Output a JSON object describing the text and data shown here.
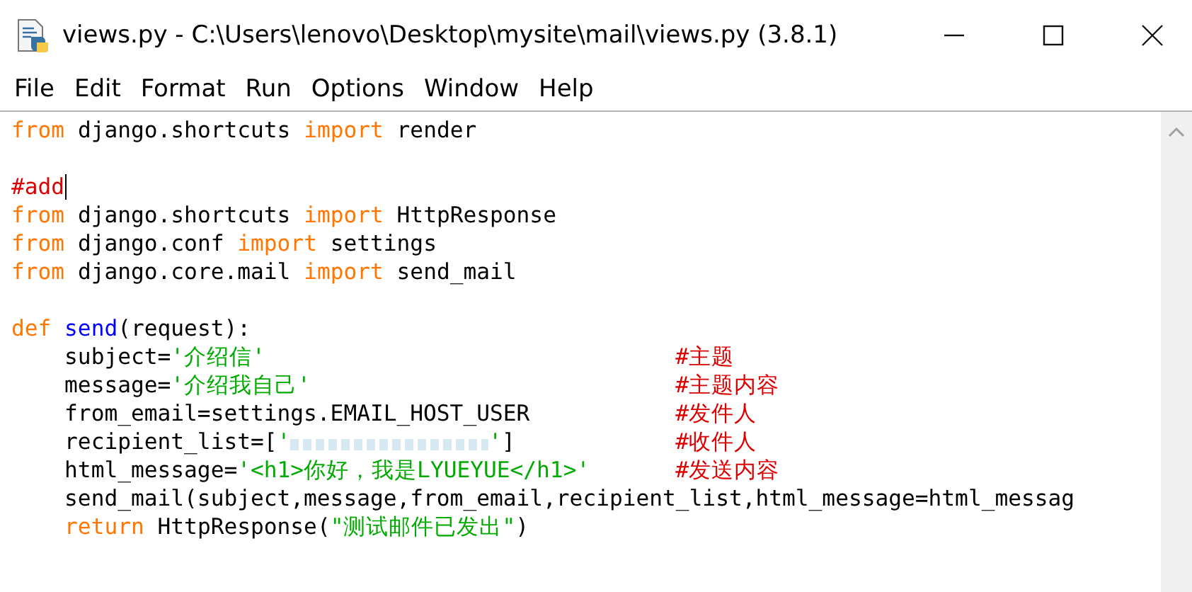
{
  "window": {
    "title": "views.py - C:\\Users\\lenovo\\Desktop\\mysite\\mail\\views.py (3.8.1)"
  },
  "menu": [
    "File",
    "Edit",
    "Format",
    "Run",
    "Options",
    "Window",
    "Help"
  ],
  "editor": {
    "lines": [
      {
        "tokens": [
          {
            "kind": "keyword",
            "text": "from"
          },
          {
            "kind": "plain",
            "text": " django.shortcuts "
          },
          {
            "kind": "keyword",
            "text": "import"
          },
          {
            "kind": "plain",
            "text": " render"
          }
        ]
      },
      {
        "blank": true
      },
      {
        "tokens": [
          {
            "kind": "comment",
            "text": "#add"
          }
        ],
        "cursor": true
      },
      {
        "tokens": [
          {
            "kind": "keyword",
            "text": "from"
          },
          {
            "kind": "plain",
            "text": " django.shortcuts "
          },
          {
            "kind": "keyword",
            "text": "import"
          },
          {
            "kind": "plain",
            "text": " HttpResponse"
          }
        ]
      },
      {
        "tokens": [
          {
            "kind": "keyword",
            "text": "from"
          },
          {
            "kind": "plain",
            "text": " django.conf "
          },
          {
            "kind": "keyword",
            "text": "import"
          },
          {
            "kind": "plain",
            "text": " settings"
          }
        ]
      },
      {
        "tokens": [
          {
            "kind": "keyword",
            "text": "from"
          },
          {
            "kind": "plain",
            "text": " django.core.mail "
          },
          {
            "kind": "keyword",
            "text": "import"
          },
          {
            "kind": "plain",
            "text": " send_mail"
          }
        ]
      },
      {
        "blank": true
      },
      {
        "tokens": [
          {
            "kind": "keyword",
            "text": "def"
          },
          {
            "kind": "definition",
            "text": "send"
          },
          {
            "kind": "plain",
            "text": "(request):"
          }
        ],
        "children": [
          {
            "tokens": [
              {
                "kind": "plain",
                "text": "subject="
              },
              {
                "kind": "string",
                "text": "'介绍信'"
              }
            ],
            "comment": "#主题"
          },
          {
            "tokens": [
              {
                "kind": "plain",
                "text": "message="
              },
              {
                "kind": "string",
                "text": "'介绍我自己'"
              }
            ],
            "comment": "#主题内容"
          },
          {
            "tokens": [
              {
                "kind": "plain",
                "text": "from_email=settings.EMAIL_HOST_USER"
              }
            ],
            "comment": "#发件人"
          },
          {
            "tokens": [
              {
                "kind": "plain",
                "text": "recipient_list=["
              },
              {
                "kind": "string",
                "text": "'"
              },
              {
                "kind": "redacted"
              },
              {
                "kind": "string",
                "text": "'"
              },
              {
                "kind": "plain",
                "text": "]"
              }
            ],
            "comment": "#收件人"
          },
          {
            "tokens": [
              {
                "kind": "plain",
                "text": "html_message="
              },
              {
                "kind": "string",
                "text": "'<h1>你好，我是LYUEYUE</h1>'"
              }
            ],
            "comment": "#发送内容"
          },
          {
            "tokens": [
              {
                "kind": "plain",
                "text": "send_mail(subject,message,from_email,recipient_list,html_message=html_messag"
              }
            ]
          },
          {
            "tokens": [
              {
                "kind": "keyword",
                "text": "return"
              },
              {
                "kind": "plain",
                "text": " HttpResponse("
              },
              {
                "kind": "string",
                "text": "\"测试邮件已发出\""
              },
              {
                "kind": "plain",
                "text": ")"
              }
            ]
          }
        ]
      }
    ]
  }
}
